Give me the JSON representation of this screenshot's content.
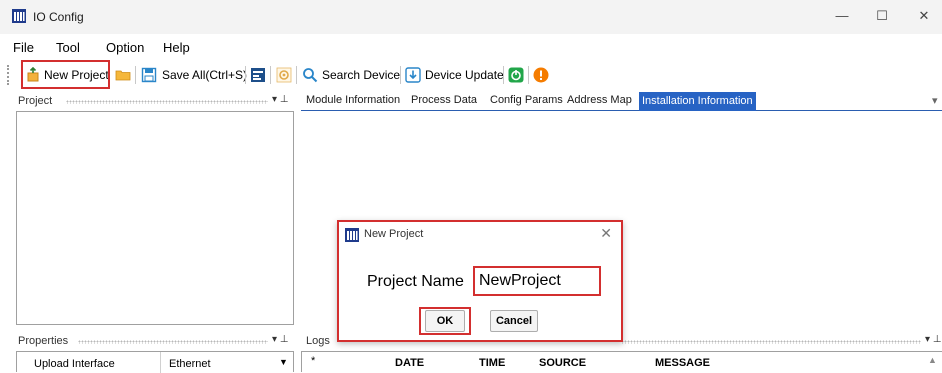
{
  "window": {
    "title": "IO Config",
    "minimize": "—",
    "maximize": "☐",
    "close": "✕"
  },
  "menu": {
    "items": [
      "File",
      "Tool",
      "Option",
      "Help"
    ]
  },
  "toolbar": {
    "new_project": "New Project",
    "save_all": "Save All(Ctrl+S)",
    "search_device": "Search Device",
    "device_update": "Device Update"
  },
  "project_panel": {
    "title": "Project",
    "pin": "▾ ⊥"
  },
  "tabs": {
    "items": [
      "Module Information",
      "Process Data",
      "Config Params",
      "Address Map",
      "Installation Information"
    ],
    "active": "Installation Information"
  },
  "properties_panel": {
    "title": "Properties",
    "rows": [
      {
        "name": "Upload Interface",
        "value": "Ethernet"
      }
    ]
  },
  "logs_panel": {
    "title": "Logs",
    "columns": [
      "*",
      "DATE",
      "TIME",
      "SOURCE",
      "MESSAGE"
    ]
  },
  "dialog": {
    "title": "New Project",
    "close": "✕",
    "label": "Project Name",
    "input_value": "NewProject",
    "ok": "OK",
    "cancel": "Cancel"
  },
  "colors": {
    "highlight": "#d32f2f",
    "active_tab": "#2763c4"
  }
}
